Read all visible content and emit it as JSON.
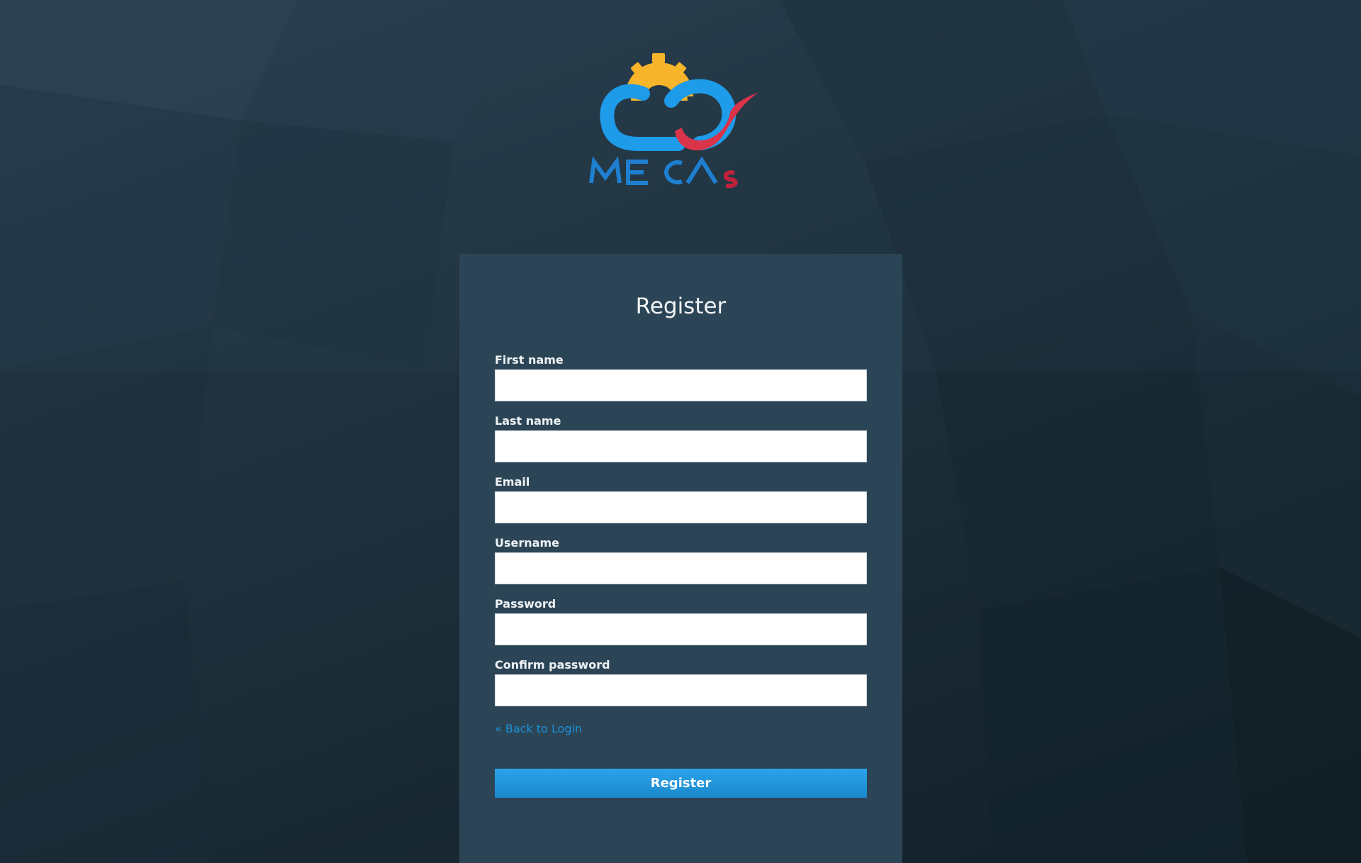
{
  "logo": {
    "text": "MECAs",
    "colors": {
      "blue": "#1e9be9",
      "yellow": "#f6b52a",
      "red": "#d9344a"
    }
  },
  "form": {
    "title": "Register",
    "fields": [
      {
        "label": "First name",
        "value": "",
        "type": "text"
      },
      {
        "label": "Last name",
        "value": "",
        "type": "text"
      },
      {
        "label": "Email",
        "value": "",
        "type": "email"
      },
      {
        "label": "Username",
        "value": "",
        "type": "text"
      },
      {
        "label": "Password",
        "value": "",
        "type": "password"
      },
      {
        "label": "Confirm password",
        "value": "",
        "type": "password"
      }
    ],
    "back_link": "« Back to Login",
    "submit_label": "Register"
  },
  "theme": {
    "accent": "#1b8fd9",
    "card_bg": "#2c4556",
    "page_bg": "#1f3340"
  }
}
